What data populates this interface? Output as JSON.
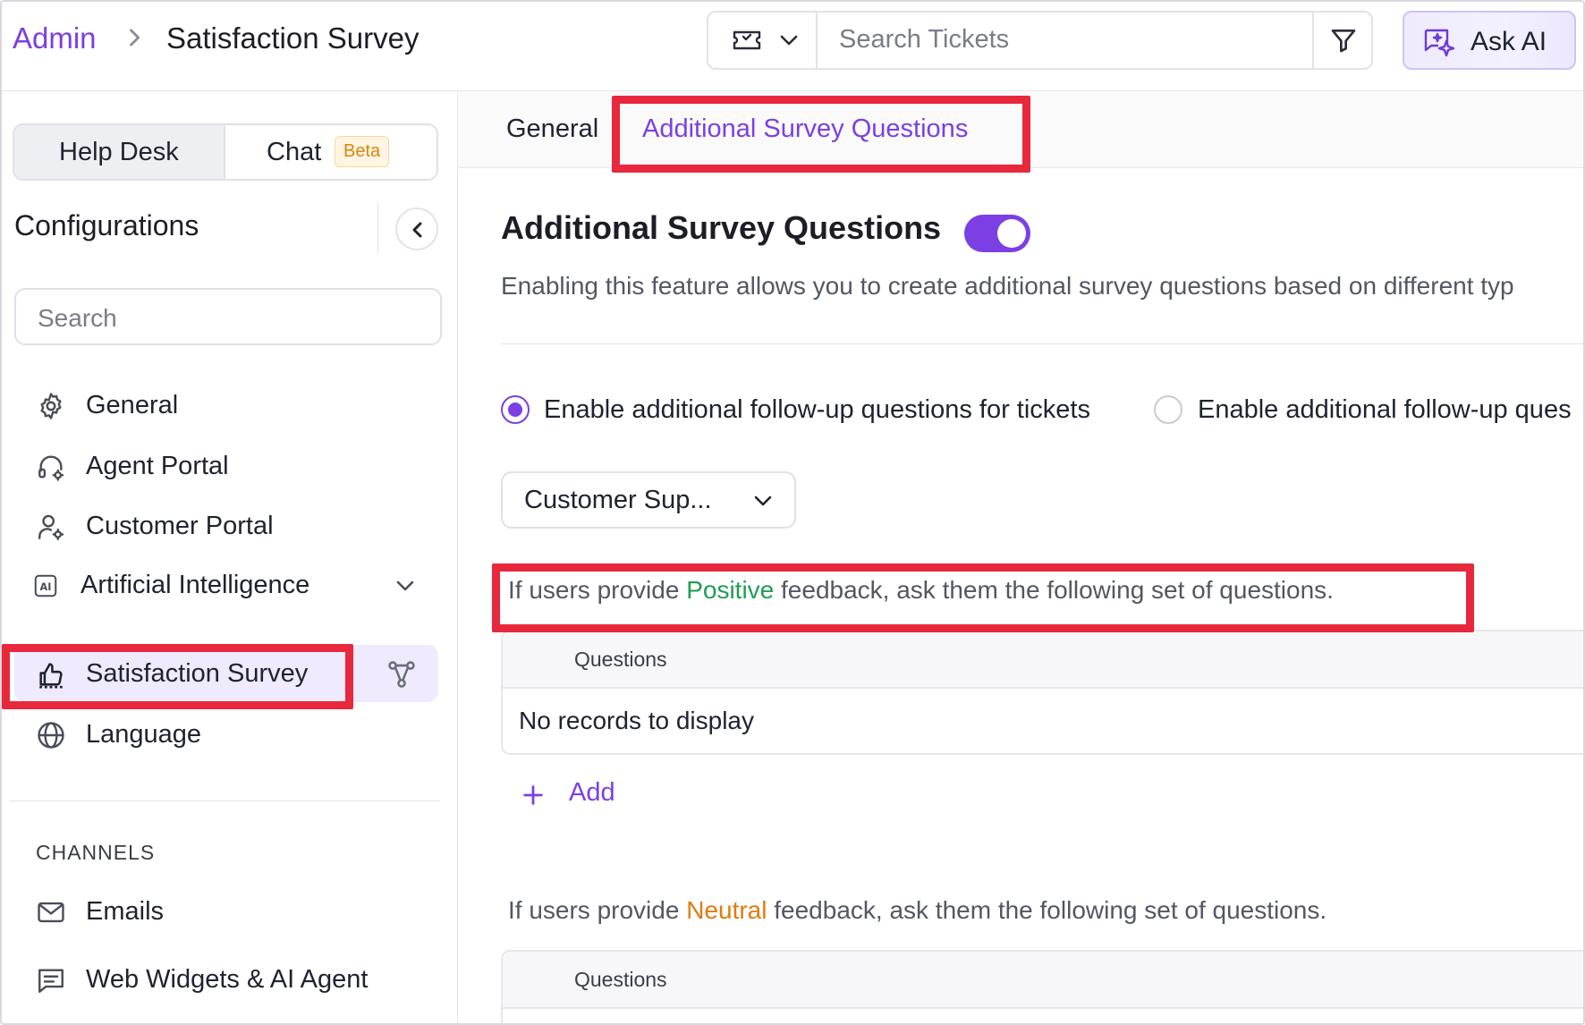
{
  "header": {
    "breadcrumb_root": "Admin",
    "breadcrumb_page": "Satisfaction Survey",
    "search_placeholder": "Search Tickets",
    "ask_ai_label": "Ask AI"
  },
  "sidebar": {
    "segments": {
      "help_desk": "Help Desk",
      "chat": "Chat",
      "chat_badge": "Beta"
    },
    "title": "Configurations",
    "search_placeholder": "Search",
    "items": [
      {
        "label": "General",
        "icon": "gear-icon"
      },
      {
        "label": "Agent Portal",
        "icon": "headset-gear-icon"
      },
      {
        "label": "Customer Portal",
        "icon": "user-gear-icon"
      },
      {
        "label": "Artificial Intelligence",
        "icon": "ai-icon",
        "expandable": true
      },
      {
        "label": "Satisfaction Survey",
        "icon": "thumbs-up-icon",
        "active": true
      },
      {
        "label": "Language",
        "icon": "globe-icon"
      }
    ],
    "channels_heading": "CHANNELS",
    "channels": [
      {
        "label": "Emails",
        "icon": "mail-icon"
      },
      {
        "label": "Web Widgets & AI Agent",
        "icon": "chat-icon"
      }
    ]
  },
  "main": {
    "tabs": [
      {
        "label": "General",
        "active": false
      },
      {
        "label": "Additional Survey Questions",
        "active": true
      }
    ],
    "section_title": "Additional Survey Questions",
    "toggle_on": true,
    "description": "Enabling this feature allows you to create additional survey questions based on different typ",
    "radios": [
      {
        "label": "Enable additional follow-up questions for tickets",
        "checked": true
      },
      {
        "label": "Enable additional follow-up ques",
        "checked": false
      }
    ],
    "select_value": "Customer Sup...",
    "positive": {
      "prefix": "If users provide ",
      "keyword": "Positive",
      "suffix": " feedback, ask them the following set of questions.",
      "column_header": "Questions",
      "empty_text": "No records to display"
    },
    "add_label": "Add",
    "neutral": {
      "prefix": "If users provide ",
      "keyword": "Neutral",
      "suffix": " feedback, ask them the following set of questions.",
      "column_header": "Questions"
    }
  },
  "colors": {
    "accent": "#7b3fe4",
    "positive": "#1f9d55",
    "neutral": "#e07b10",
    "highlight": "#e8283c"
  }
}
